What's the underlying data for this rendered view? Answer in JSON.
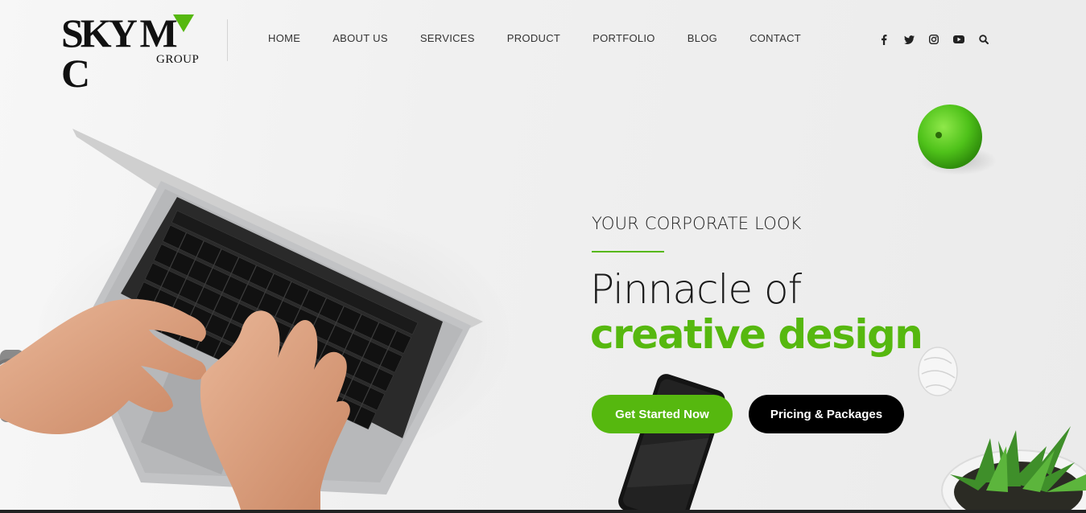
{
  "brand": {
    "logo_main_a": "SKY",
    "logo_main_b": "M",
    "logo_main_c": "C",
    "logo_sub": "GROUP",
    "accent_color": "#56b80f"
  },
  "nav": {
    "items": [
      {
        "label": "HOME"
      },
      {
        "label": "ABOUT US"
      },
      {
        "label": "SERVICES"
      },
      {
        "label": "PRODUCT"
      },
      {
        "label": "PORTFOLIO"
      },
      {
        "label": "BLOG"
      },
      {
        "label": "CONTACT"
      }
    ]
  },
  "social": {
    "icons": [
      "facebook-icon",
      "twitter-icon",
      "instagram-icon",
      "youtube-icon",
      "search-icon"
    ]
  },
  "hero": {
    "eyebrow": "YOUR CORPORATE LOOK",
    "headline_line1": "Pinnacle of",
    "headline_line2": "creative design",
    "primary_button": "Get Started Now",
    "secondary_button": "Pricing & Packages"
  }
}
